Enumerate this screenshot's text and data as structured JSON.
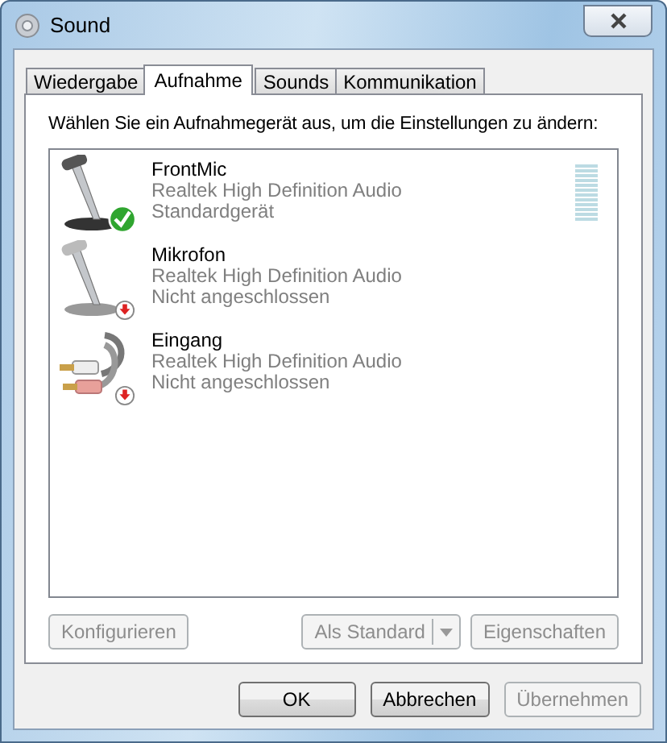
{
  "window": {
    "title": "Sound"
  },
  "tabs": [
    {
      "label": "Wiedergabe",
      "selected": false
    },
    {
      "label": "Aufnahme",
      "selected": true
    },
    {
      "label": "Sounds",
      "selected": false
    },
    {
      "label": "Kommunikation",
      "selected": false
    }
  ],
  "instruction": "Wählen Sie ein Aufnahmegerät aus, um die Einstellungen zu ändern:",
  "devices": [
    {
      "kind": "microphone",
      "name": "FrontMic",
      "driver": "Realtek High Definition Audio",
      "status": "Standardgerät",
      "default": true,
      "unplugged": false
    },
    {
      "kind": "microphone",
      "name": "Mikrofon",
      "driver": "Realtek High Definition Audio",
      "status": "Nicht angeschlossen",
      "default": false,
      "unplugged": true
    },
    {
      "kind": "line-in",
      "name": "Eingang",
      "driver": "Realtek High Definition Audio",
      "status": "Nicht angeschlossen",
      "default": false,
      "unplugged": true
    }
  ],
  "panel_buttons": {
    "configure": {
      "label": "Konfigurieren",
      "disabled": true
    },
    "set_default": {
      "label": "Als Standard",
      "disabled": true
    },
    "properties": {
      "label": "Eigenschaften",
      "disabled": true
    }
  },
  "dialog_buttons": [
    {
      "label": "OK",
      "disabled": false
    },
    {
      "label": "Abbrechen",
      "disabled": false
    },
    {
      "label": "Übernehmen",
      "disabled": true
    }
  ]
}
